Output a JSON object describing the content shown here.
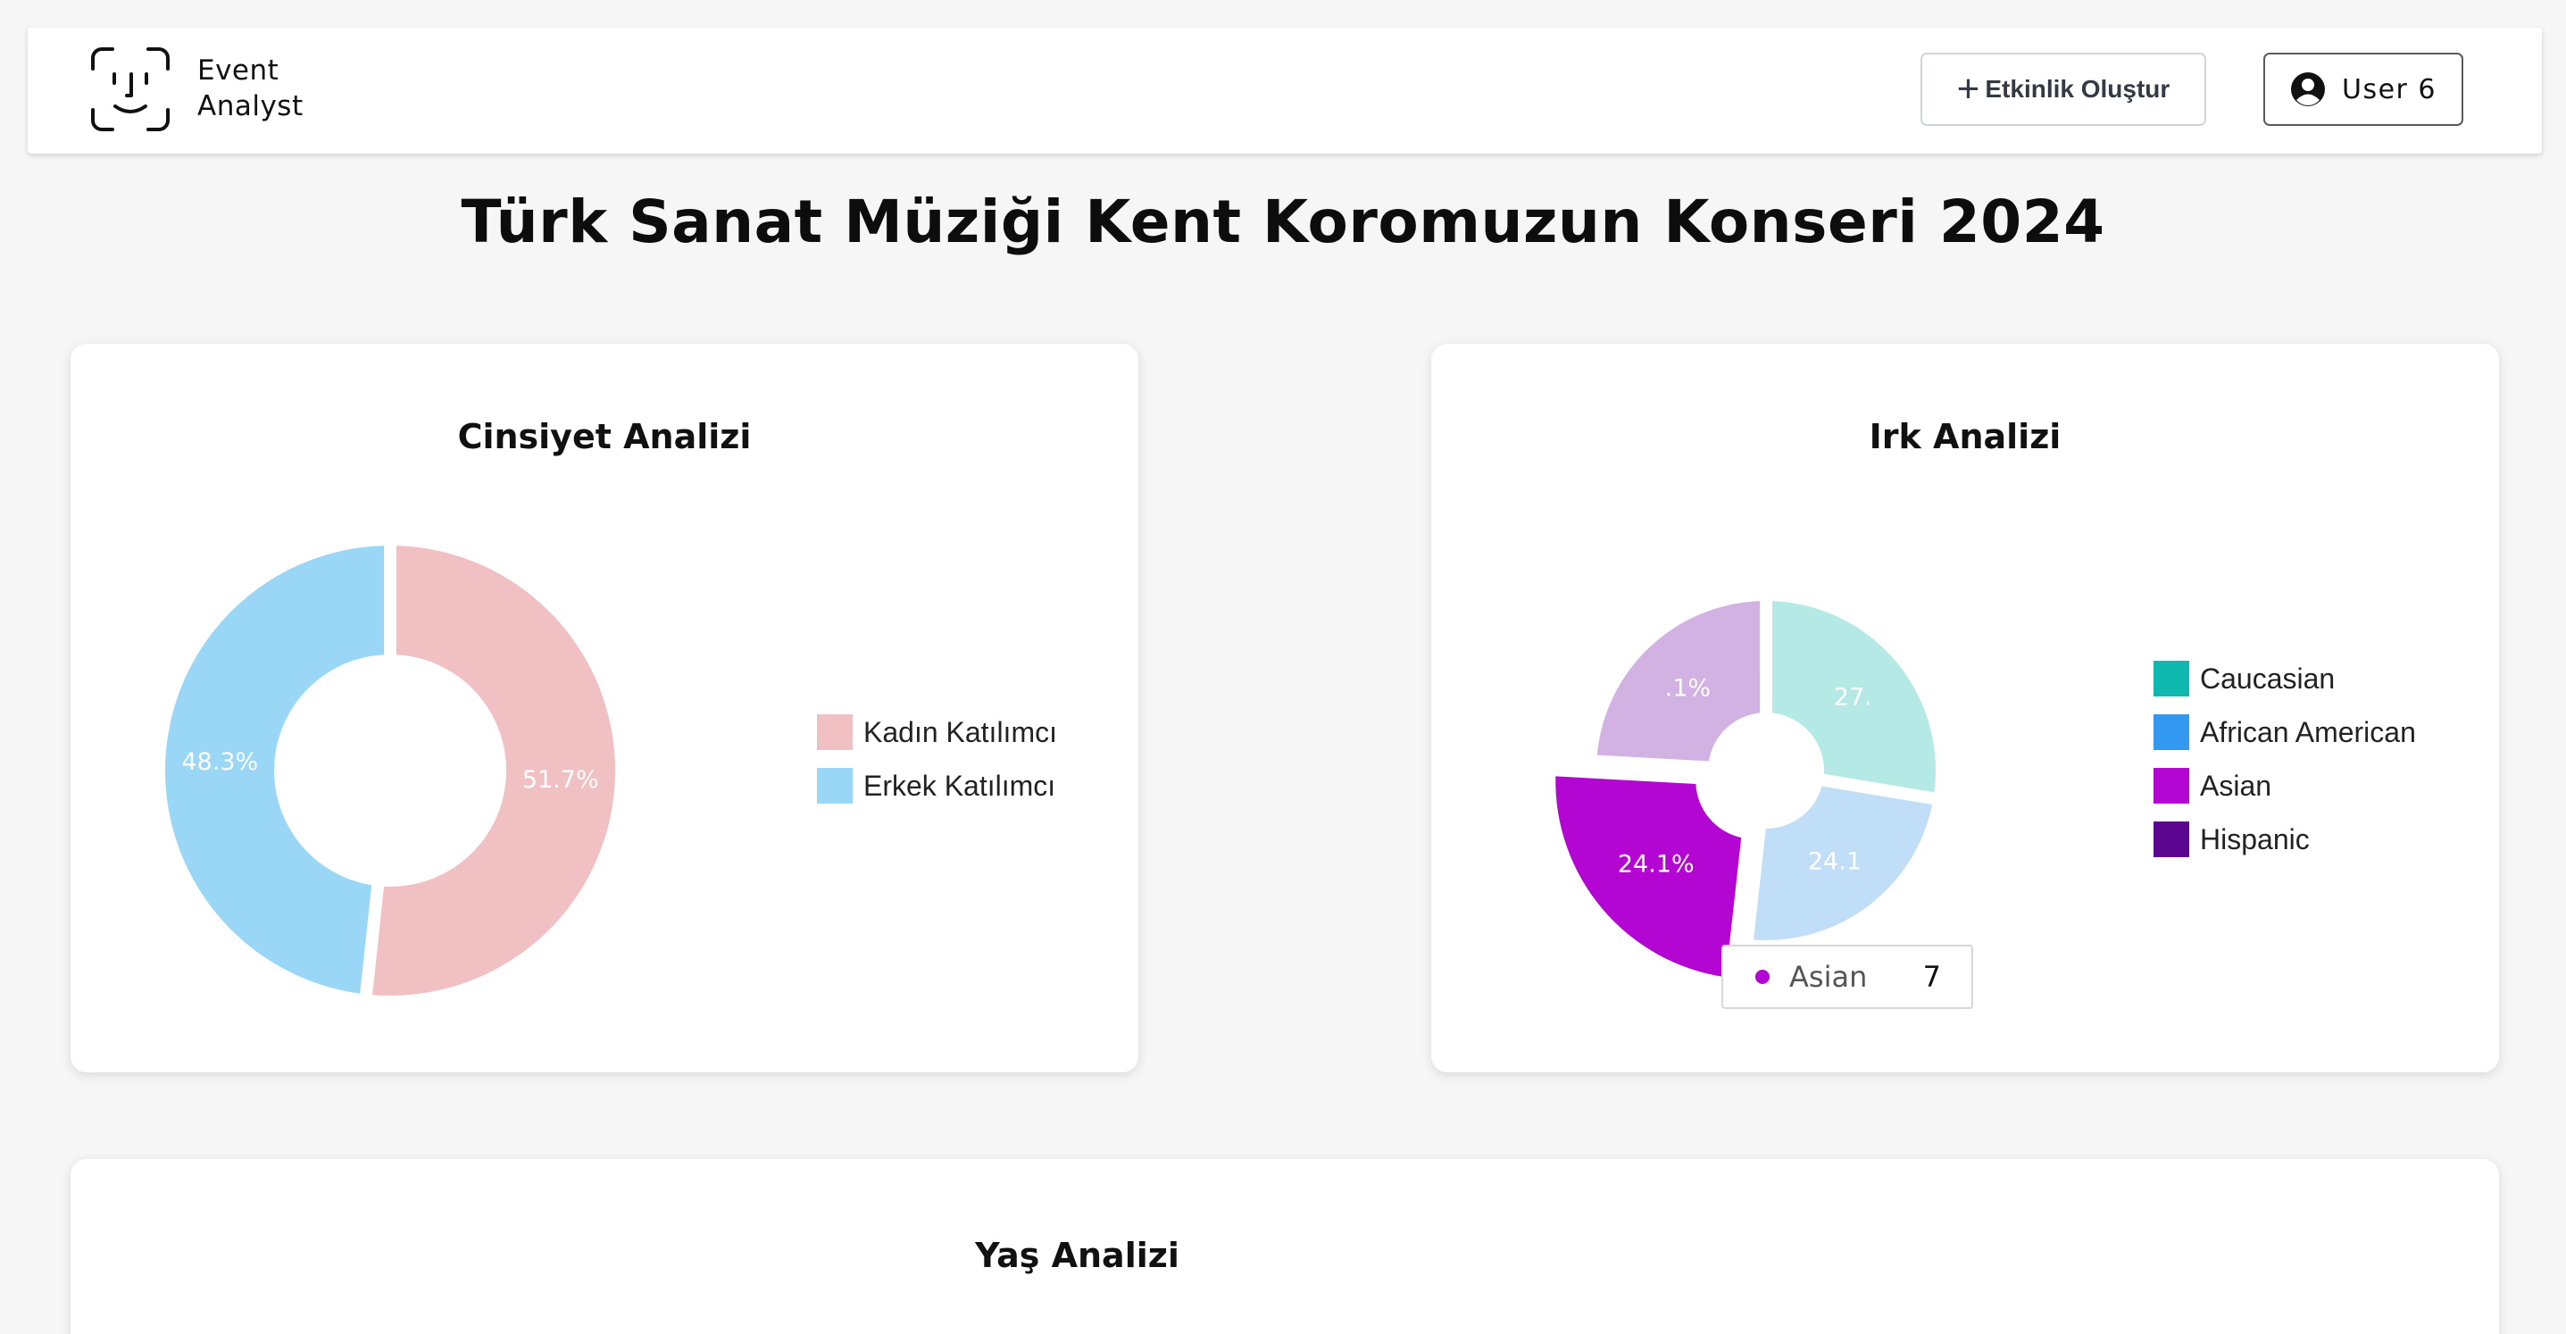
{
  "app": {
    "logo_line1": "Event",
    "logo_line2": "Analyst"
  },
  "header": {
    "create_label": "Etkinlik Oluştur",
    "user_label": "User 6"
  },
  "page": {
    "title": "Türk Sanat Müziği Kent Koromuzun Konseri 2024"
  },
  "cards": {
    "gender_title": "Cinsiyet Analizi",
    "race_title": "Irk Analizi",
    "age_title": "Yaş Analizi"
  },
  "tooltip": {
    "label": "Asian",
    "value": "7",
    "color": "#b406d2"
  },
  "chart_data": [
    {
      "type": "pie",
      "title": "Cinsiyet Analizi",
      "donut": true,
      "legend_position": "right",
      "slices": [
        {
          "label": "Kadın Katılımcı",
          "value": 51.7,
          "display": "51.7%",
          "color": "#f0c0c2"
        },
        {
          "label": "Erkek Katılımcı",
          "value": 48.3,
          "display": "48.3%",
          "color": "#9ad6f5"
        }
      ]
    },
    {
      "type": "pie",
      "title": "Irk Analizi",
      "donut": true,
      "legend_position": "right",
      "slices": [
        {
          "label": "Caucasian",
          "value": 27.6,
          "display": "27.",
          "color": "#0fb8ae",
          "shown_color": "#b5e9e6"
        },
        {
          "label": "African American",
          "value": 24.1,
          "display": "24.1",
          "color": "#3399f0",
          "shown_color": "#c1def9"
        },
        {
          "label": "Asian",
          "value": 24.1,
          "display": "24.1%",
          "color": "#b406d2",
          "shown_color": "#b406d2"
        },
        {
          "label": "Hispanic",
          "value": 24.1,
          "display": ".1%",
          "color": "#5c0590",
          "shown_color": "#d1b2e2"
        }
      ]
    }
  ]
}
